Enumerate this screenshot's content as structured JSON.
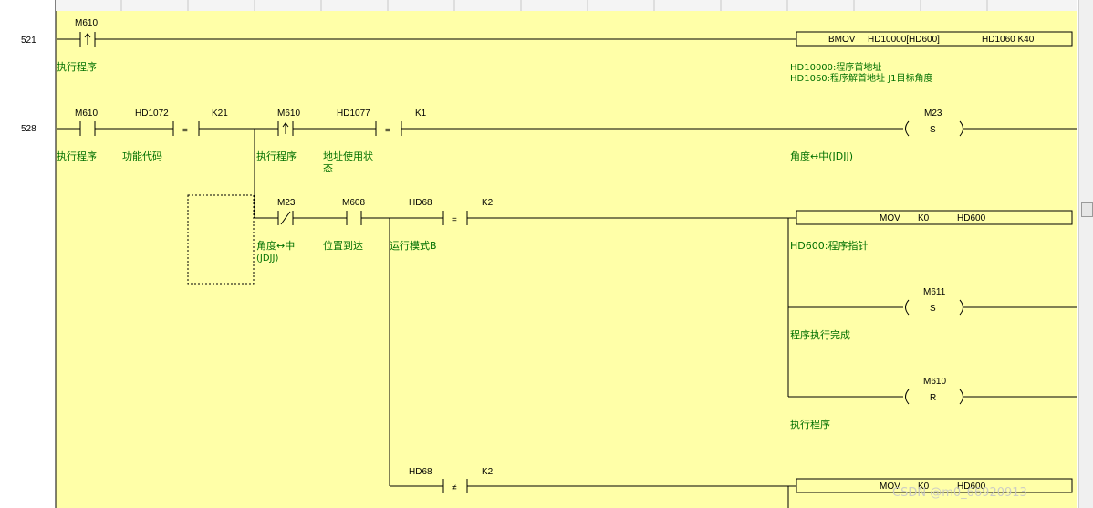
{
  "steps": [
    "521",
    "528"
  ],
  "contacts": {
    "m610_a": "M610",
    "m610_b": "M610",
    "hd1072": "HD1072",
    "k21": "K21",
    "hd1077": "HD1077",
    "k1": "K1",
    "m23": "M23",
    "m608": "M608",
    "hd68_a": "HD68",
    "k2_a": "K2",
    "hd68_b": "HD68",
    "k2_b": "K2"
  },
  "compare_symbols": {
    "eq1": "=",
    "eq2": "=",
    "eq3": "=",
    "neq": "≠"
  },
  "instructions": {
    "bmov": {
      "op": "BMOV",
      "args": [
        "HD10000[HD600]",
        "HD1060 K40"
      ]
    },
    "mov1": {
      "op": "MOV",
      "args": [
        "K0",
        "HD600"
      ]
    },
    "mov2": {
      "op": "MOV",
      "args": [
        "K0",
        "HD600"
      ]
    }
  },
  "coils": {
    "m23": {
      "label": "M23",
      "type": "S"
    },
    "m611": {
      "label": "M611",
      "type": "S"
    },
    "m610": {
      "label": "M610",
      "type": "R"
    }
  },
  "comments": {
    "exec_prog_1": "执行程序",
    "bmov_c1": "HD10000:程序首地址",
    "bmov_c2": "HD1060:程序解首地址 J1目标角度",
    "exec_prog_2": "执行程序",
    "func_code": "功能代码",
    "exec_prog_3": "执行程序",
    "addr_state_1": "地址使用状",
    "addr_state_2": "态",
    "angle_mid_coil": "角度↔中(JDJJ)",
    "angle_mid_1": "角度↔中",
    "angle_mid_2": "(JDJJ)",
    "pos_reach": "位置到达",
    "run_mode": "运行模式B",
    "hd600_ptr": "HD600:程序指针",
    "prog_done": "程序执行完成",
    "exec_prog_4": "执行程序"
  },
  "watermark": "CSDN @m0_66920913"
}
